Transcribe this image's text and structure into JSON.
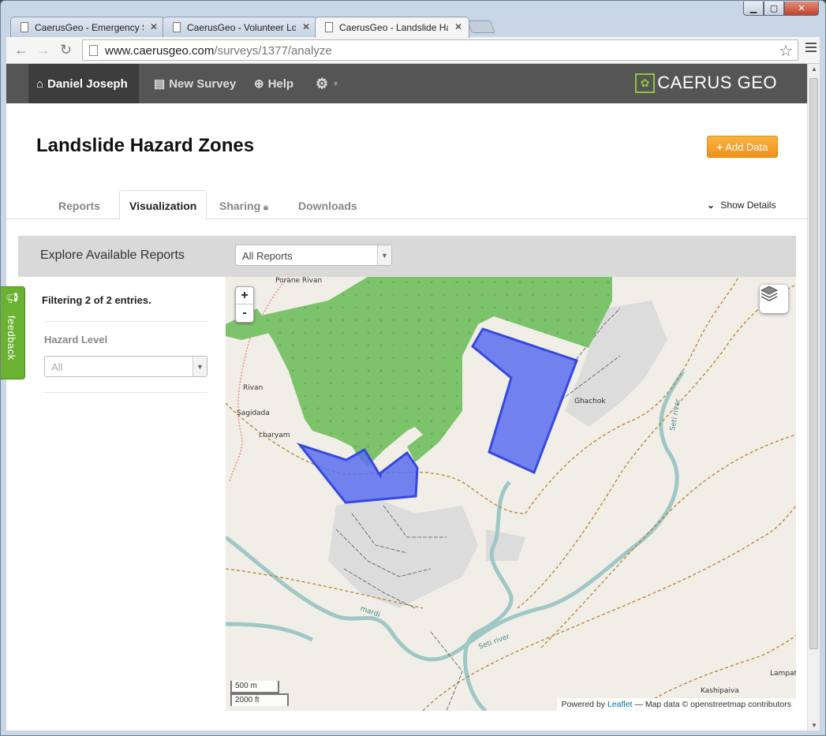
{
  "browser": {
    "tabs": [
      {
        "title": "CaerusGeo - Emergency S"
      },
      {
        "title": "CaerusGeo - Volunteer Lo"
      },
      {
        "title": "CaerusGeo - Landslide Ha"
      }
    ],
    "url_domain": "www.caerusgeo.com",
    "url_path": "/surveys/1377/analyze"
  },
  "navbar": {
    "user": "Daniel Joseph",
    "new_survey": "New Survey",
    "help": "Help",
    "brand": "CAERUS GEO"
  },
  "page": {
    "title": "Landslide Hazard Zones",
    "add_data": "Add Data",
    "tabs": [
      "Reports",
      "Visualization",
      "Sharing",
      "Downloads"
    ],
    "active_tab": "Visualization",
    "show_details": "Show Details"
  },
  "explore": {
    "label": "Explore Available Reports",
    "select_value": "All Reports"
  },
  "sidebar": {
    "filter_text": "Filtering 2 of 2 entries.",
    "hazard_label": "Hazard Level",
    "hazard_value": "All"
  },
  "feedback": "feedback",
  "map": {
    "zoom_in": "+",
    "zoom_out": "-",
    "scale_metric": "500 m",
    "scale_imperial": "2000 ft",
    "attribution_prefix": "Powered by",
    "attribution_link": "Leaflet",
    "attribution_suffix": "— Map data © openstreetmap contributors",
    "place_labels": [
      "Porane Rivan",
      "Rivan",
      "Sagidada",
      "charyam",
      "Ghachok",
      "Seti river",
      "mardi",
      "Seti river",
      "Kashipaiva",
      "Lampata"
    ],
    "colors": {
      "forest": "#7cc36b",
      "hazard": "#5a6ff0",
      "water": "#9fc7c5"
    }
  }
}
